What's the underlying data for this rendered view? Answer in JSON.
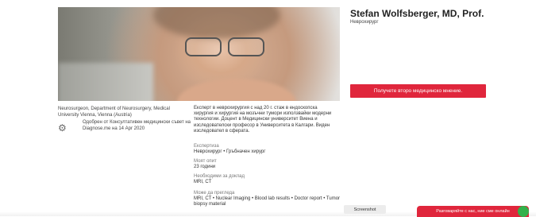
{
  "doctor": {
    "name": "Stefan Wolfsberger, MD, Prof.",
    "specialty": "Неврохирург",
    "affiliation": "Neurosurgeon, Department of Neurosurgery, Medical University Vienna, Vienna (Austria)",
    "verified_text": "Одобрен от Консултативен медицински съвет на Diagnose.me на 14 Apr 2020",
    "bio": "Експерт в неврохирургия с над 20 г. стаж в ендоскопска хирургия и хирургия на мозъчни тумори използвайки модерни технологии. Доцент в Медицински университет Виена и изследователски професор в Университета в Калгари. Виден изследовател в сферата."
  },
  "actions": {
    "second_opinion_button": "Получете второ медицинско мнение."
  },
  "fields": {
    "expertise": {
      "label": "Експертиза",
      "value": "Неврохирург • Гръбначен хирург"
    },
    "experience": {
      "label": "Моят опит",
      "value": "23 години"
    },
    "report_needed": {
      "label": "Необходими за доклад",
      "value": "MRI, CT"
    },
    "can_review": {
      "label": "Може да прегледа",
      "value": "MRI, CT • Nuclear Imaging • Blood lab results • Doctor report • Tumor biopsy material"
    }
  },
  "overlay": {
    "tooltip": "Screenshot",
    "chat_button": "Разговаряйте с нас, ние сме онлайн"
  },
  "icons": {
    "verified": "gear-icon"
  },
  "colors": {
    "accent": "#e0263c",
    "online": "#33b14b"
  }
}
